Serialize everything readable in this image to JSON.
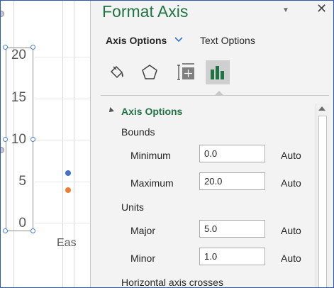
{
  "chart": {
    "y_ticks": [
      "20",
      "15",
      "10",
      "5",
      "0"
    ],
    "category_label": "Eas",
    "series_colors": [
      "#4472c4",
      "#ed7d31"
    ]
  },
  "pane": {
    "title": "Format Axis",
    "tabs": {
      "axis_options": "Axis Options",
      "text_options": "Text Options"
    },
    "category_icons": [
      "fill-line-icon",
      "effects-icon",
      "size-properties-icon",
      "axis-options-icon"
    ],
    "section_title": "Axis Options",
    "bounds": {
      "label": "Bounds",
      "minimum": {
        "label": "Minimum",
        "value": "0.0",
        "auto": "Auto"
      },
      "maximum": {
        "label": "Maximum",
        "value": "20.0",
        "auto": "Auto"
      }
    },
    "units": {
      "label": "Units",
      "major": {
        "label": "Major",
        "value": "5.0",
        "auto": "Auto"
      },
      "minor": {
        "label": "Minor",
        "value": "1.0",
        "auto": "Auto"
      }
    },
    "horizontal_axis_crosses": "Horizontal axis crosses",
    "accent_color": "#217346"
  }
}
